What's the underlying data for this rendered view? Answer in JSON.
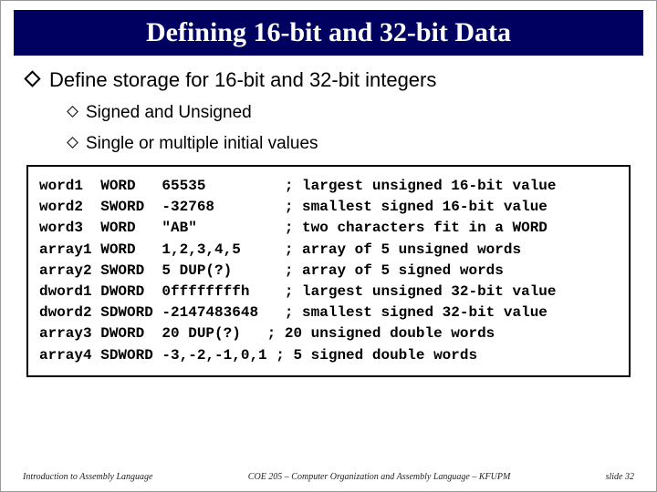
{
  "title": "Defining 16-bit and 32-bit Data",
  "main_bullet": "Define storage for 16-bit and 32-bit integers",
  "sub_bullets": [
    "Signed and Unsigned",
    "Single or multiple initial values"
  ],
  "code_lines": [
    "word1  WORD   65535         ; largest unsigned 16-bit value",
    "word2  SWORD  -32768        ; smallest signed 16-bit value",
    "word3  WORD   \"AB\"          ; two characters fit in a WORD",
    "array1 WORD   1,2,3,4,5     ; array of 5 unsigned words",
    "array2 SWORD  5 DUP(?)      ; array of 5 signed words",
    "dword1 DWORD  0ffffffffh    ; largest unsigned 32-bit value",
    "dword2 SDWORD -2147483648   ; smallest signed 32-bit value",
    "array3 DWORD  20 DUP(?)   ; 20 unsigned double words",
    "array4 SDWORD -3,-2,-1,0,1 ; 5 signed double words"
  ],
  "footer": {
    "left": "Introduction to Assembly Language",
    "center": "COE 205 – Computer Organization and Assembly Language – KFUPM",
    "right": "slide 32"
  }
}
